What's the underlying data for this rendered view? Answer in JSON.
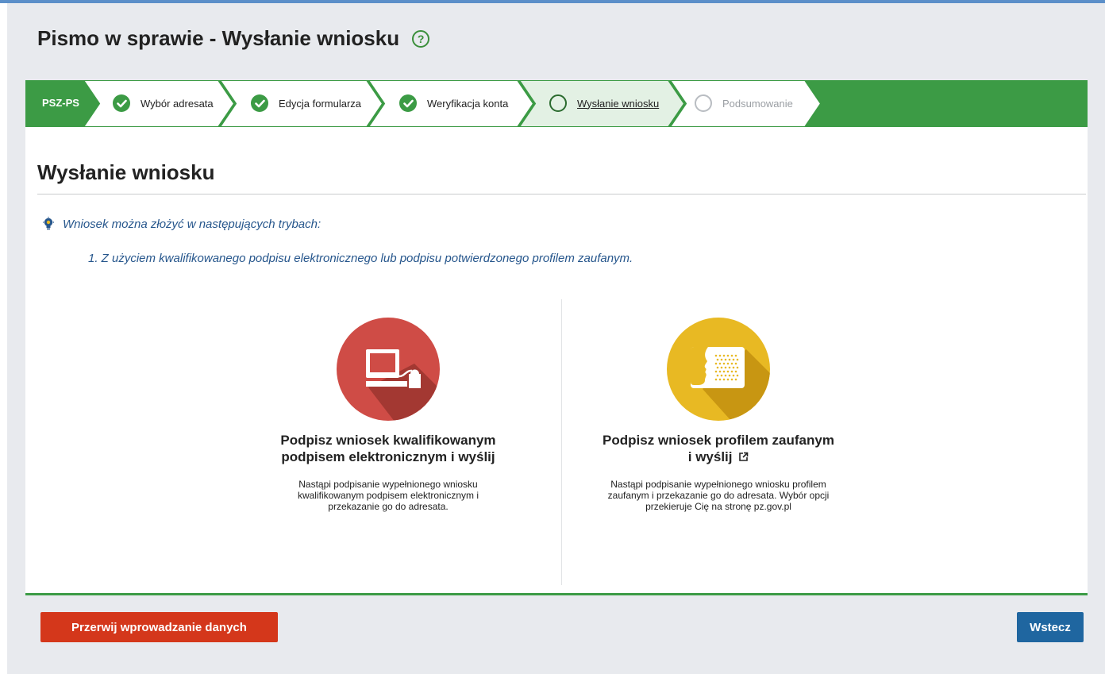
{
  "page": {
    "title": "Pismo w sprawie - Wysłanie wniosku",
    "help_icon": "question-circle-icon"
  },
  "stepper": {
    "code": "PSZ-PS",
    "steps": [
      {
        "label": "Wybór adresata",
        "status": "done"
      },
      {
        "label": "Edycja formularza",
        "status": "done"
      },
      {
        "label": "Weryfikacja konta",
        "status": "done"
      },
      {
        "label": "Wysłanie wniosku",
        "status": "current"
      },
      {
        "label": "Podsumowanie",
        "status": "pending"
      }
    ]
  },
  "main": {
    "section_title": "Wysłanie wniosku",
    "hint": "Wniosek można złożyć w następujących trybach:",
    "mode": "1. Z użyciem kwalifikowanego podpisu elektronicznego lub podpisu potwierdzonego profilem zaufanym.",
    "options": [
      {
        "title_line1": "Podpisz wniosek kwalifikowanym",
        "title_line2": "podpisem elektronicznym i wyślij",
        "description": "Nastąpi podpisanie wypełnionego wniosku kwalifikowanym podpisem elektronicznym i przekazanie go do adresata.",
        "icon": "computer-signature-icon"
      },
      {
        "title_line1": "Podpisz wniosek profilem zaufanym",
        "title_line2": "i wyślij",
        "description": "Nastąpi podpisanie wypełnionego wniosku profilem zaufanym i przekazanie go do adresata. Wybór opcji przekieruje Cię na stronę pz.gov.pl",
        "icon": "trusted-profile-icon"
      }
    ]
  },
  "footer": {
    "cancel_label": "Przerwij wprowadzanie danych",
    "back_label": "Wstecz"
  },
  "colors": {
    "accent_green": "#3c9b45",
    "cancel_red": "#d4371b",
    "back_blue": "#1f66a0",
    "hint_blue": "#26568c",
    "icon_red": "#cf4c46",
    "icon_yellow": "#e8b923"
  }
}
